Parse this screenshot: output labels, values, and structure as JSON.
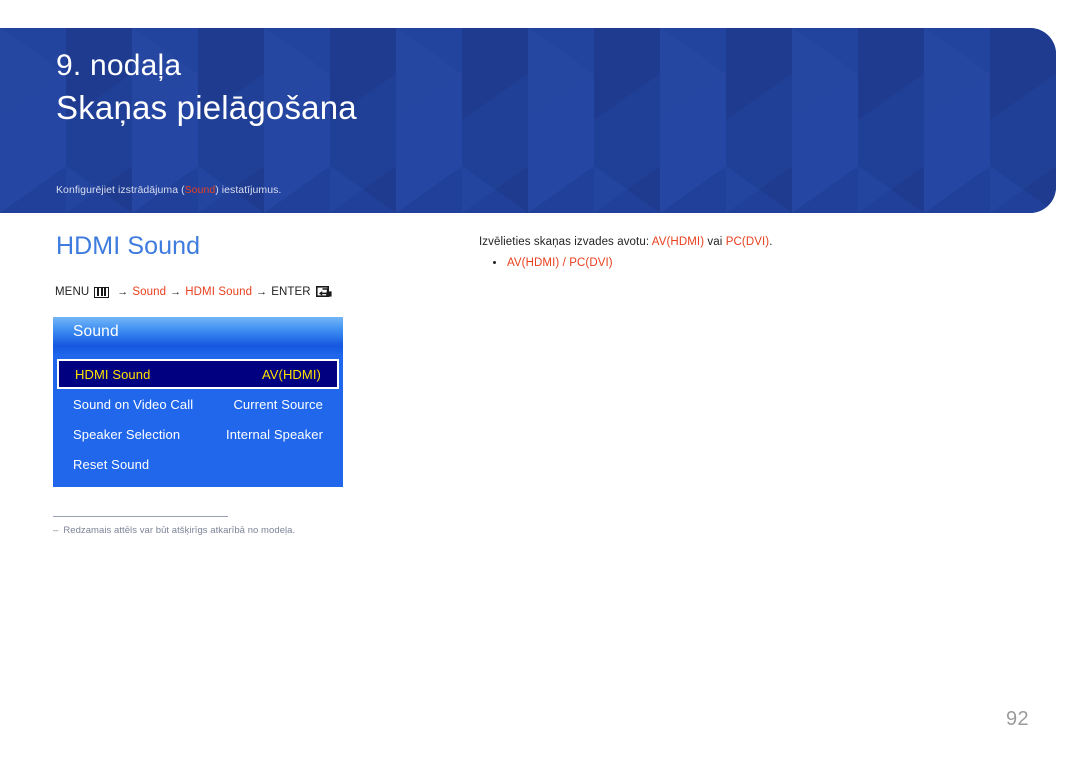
{
  "header": {
    "chapter": "9. nodaļa",
    "chapter_title": "Skaņas pielāgošana",
    "subtitle_before": "Konfigurējiet izstrādājuma (",
    "subtitle_highlight": "Sound",
    "subtitle_after": ") iestatījumus.",
    "bg_color": "#21409A",
    "accent_color": "#E8401F"
  },
  "section": {
    "title": "HDMI Sound",
    "title_color": "#3E7BDE"
  },
  "menu_path": {
    "menu_label": "MENU",
    "menu_icon": "menu-grid-icon",
    "arrow": "→",
    "step1": "Sound",
    "step2": "HDMI Sound",
    "enter_label": "ENTER",
    "enter_icon": "enter-return-icon"
  },
  "osd": {
    "title": "Sound",
    "rows": [
      {
        "label": "HDMI Sound",
        "value": "AV(HDMI)",
        "selected": true
      },
      {
        "label": "Sound on Video Call",
        "value": "Current Source",
        "selected": false
      },
      {
        "label": "Speaker Selection",
        "value": "Internal Speaker",
        "selected": false
      },
      {
        "label": "Reset Sound",
        "value": "",
        "selected": false
      }
    ],
    "body_color": "#2067EC",
    "selected_bg": "#000080",
    "selected_text": "#FFE100"
  },
  "right": {
    "intro_part1": "Izvēlieties skaņas izvades avotu: ",
    "intro_hl1": "AV(HDMI)",
    "intro_part2": " vai ",
    "intro_hl2": "PC(DVI)",
    "intro_part3": ".",
    "bullets": [
      "AV(HDMI) / PC(DVI)"
    ]
  },
  "footnote": {
    "dash": "‒",
    "text": "Redzamais attēls var būt atšķirīgs atkarībā no modeļa."
  },
  "page_number": "92"
}
